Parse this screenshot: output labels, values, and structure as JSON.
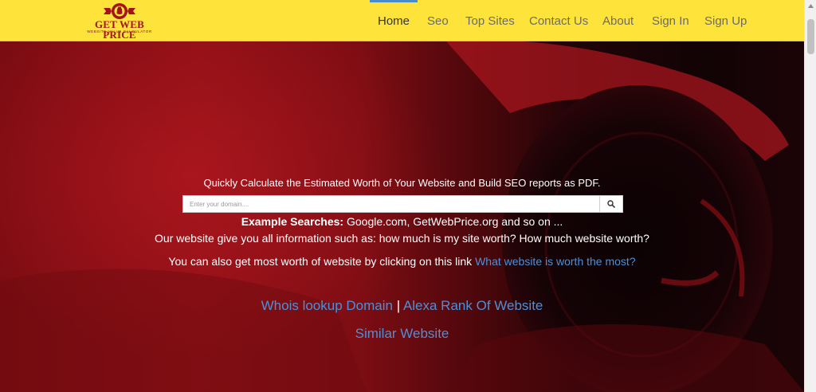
{
  "brand": {
    "name": "GET WEB PRICE",
    "tagline": "WEBSITE VALUE CALCULATOR"
  },
  "nav": {
    "items": [
      "Home",
      "Seo",
      "Top Sites",
      "Contact Us",
      "About",
      "Sign In",
      "Sign Up"
    ],
    "active": "Home"
  },
  "hero": {
    "headline": "Quickly Calculate the Estimated Worth of Your Website and Build SEO reports as PDF.",
    "search": {
      "placeholder": "Enter your domain....",
      "value": "",
      "button_icon": "search-icon"
    },
    "examples_label": "Example Searches:",
    "examples_text": " Google.com, GetWebPrice.org and so on ...",
    "info_text": "Our website give you all information such as: how much is my site worth? How much website worth?",
    "link_prefix": "You can also get most worth of website by clicking on this link ",
    "link_text": "What website is worth the most?",
    "tool_links": [
      "Whois lookup Domain",
      "Alexa Rank Of Website",
      "Similar Website"
    ],
    "tool_separator": "|"
  },
  "colors": {
    "navbar_bg": "#fde33a",
    "brand_red": "#a3131a",
    "active_indicator": "#4a8bc9",
    "link_blue": "#4f8fd6",
    "hero_red": "#8e1016"
  }
}
